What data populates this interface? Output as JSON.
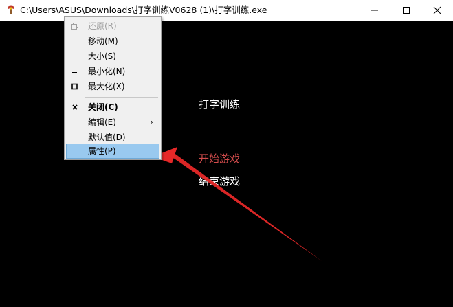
{
  "window": {
    "title": "C:\\Users\\ASUS\\Downloads\\打字训练V0628 (1)\\打字训练.exe",
    "icon": "app-icon"
  },
  "console": {
    "game_title": "打字训练",
    "start_game": "开始游戏",
    "end_game": "结束游戏",
    "start_color": "#d04b4b"
  },
  "system_menu": {
    "items": [
      {
        "label": "还原(R)",
        "enabled": false
      },
      {
        "label": "移动(M)",
        "enabled": true
      },
      {
        "label": "大小(S)",
        "enabled": true
      },
      {
        "label": "最小化(N)",
        "enabled": true
      },
      {
        "label": "最大化(X)",
        "enabled": true
      },
      {
        "label": "关闭(C)",
        "enabled": true,
        "bold": true
      },
      {
        "label": "编辑(E)",
        "enabled": true,
        "submenu": true
      },
      {
        "label": "默认值(D)",
        "enabled": true
      },
      {
        "label": "属性(P)",
        "enabled": true,
        "highlighted": true
      }
    ],
    "submenu_glyph": "›",
    "highlight_color": "#99c9ef"
  },
  "annotation": {
    "arrow_color": "#e62828"
  }
}
